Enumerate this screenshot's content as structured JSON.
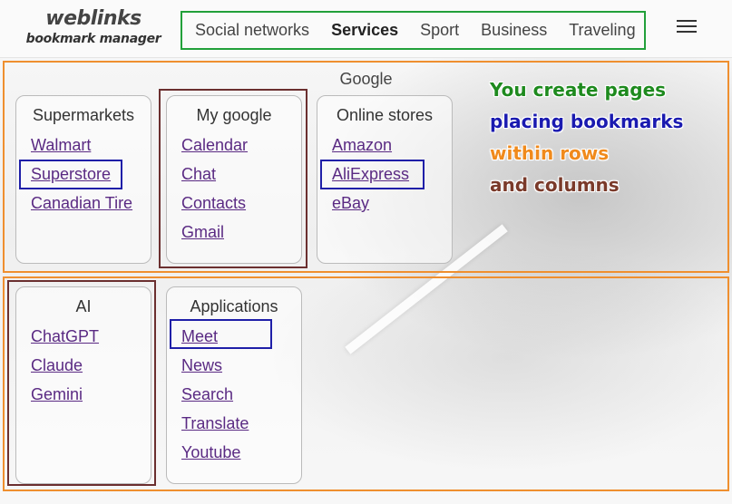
{
  "logo": {
    "title": "weblinks",
    "subtitle": "bookmark manager"
  },
  "nav": {
    "items": [
      {
        "label": "Social networks",
        "active": false
      },
      {
        "label": "Services",
        "active": true
      },
      {
        "label": "Sport",
        "active": false
      },
      {
        "label": "Business",
        "active": false
      },
      {
        "label": "Traveling",
        "active": false
      }
    ]
  },
  "promo": {
    "lines": [
      {
        "text": "You create pages",
        "color": "#1e8a1e"
      },
      {
        "text": "placing bookmarks",
        "color": "#1a1ab0"
      },
      {
        "text": "within rows",
        "color": "#f08a1c"
      },
      {
        "text": "and columns",
        "color": "#7a3a2a"
      }
    ]
  },
  "rows": [
    {
      "title": "Google",
      "columns": [
        {
          "title": "Supermarkets",
          "links": [
            "Walmart",
            "Superstore",
            "Canadian Tire"
          ]
        },
        {
          "title": "My google",
          "links": [
            "Calendar",
            "Chat",
            "Contacts",
            "Gmail"
          ]
        },
        {
          "title": "Online stores",
          "links": [
            "Amazon",
            "AliExpress",
            "eBay"
          ]
        }
      ]
    },
    {
      "title": "",
      "columns": [
        {
          "title": "AI",
          "links": [
            "ChatGPT",
            "Claude",
            "Gemini"
          ]
        },
        {
          "title": "Applications",
          "links": [
            "Meet",
            "News",
            "Search",
            "Translate",
            "Youtube"
          ]
        }
      ]
    }
  ]
}
